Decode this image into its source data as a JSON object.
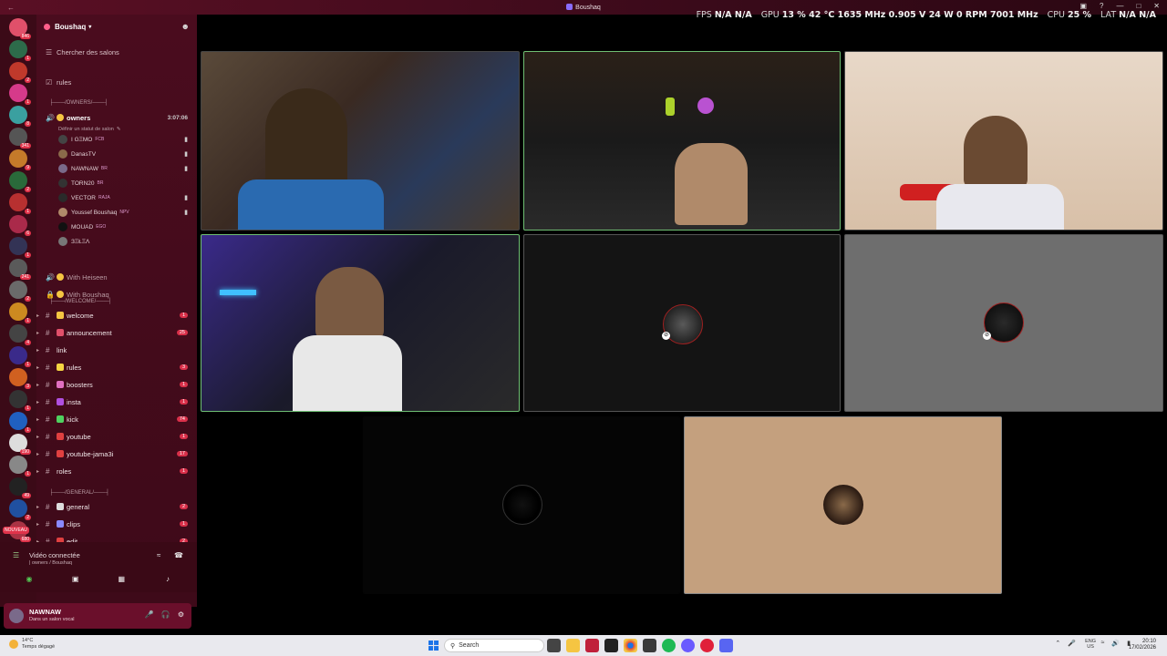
{
  "window": {
    "title": "Boushaq"
  },
  "overlay": {
    "fps_label": "FPS",
    "fps_a": "N/A",
    "fps_b": "N/A",
    "gpu_label": "GPU",
    "gpu_load": "13 %",
    "gpu_temp": "42 °C",
    "gpu_clock": "1635 MHz",
    "gpu_volt": "0.905 V",
    "gpu_power": "24 W",
    "gpu_fan": "0 RPM",
    "gpu_mem": "7001 MHz",
    "cpu_label": "CPU",
    "cpu_load": "25 %",
    "lat_label": "LAT",
    "lat_a": "N/A",
    "lat_b": "N/A"
  },
  "guilds": {
    "icons": [
      {
        "name": "discord-home",
        "color": "#e0506a",
        "badge": "846"
      },
      {
        "name": "guild-1",
        "color": "#2d6b4a",
        "badge": "1"
      },
      {
        "name": "guild-2",
        "color": "#c0392b",
        "badge": "2"
      },
      {
        "name": "guild-p",
        "color": "#d63a8a",
        "badge": "1"
      },
      {
        "name": "guild-4",
        "color": "#3aa0a0",
        "badge": "8"
      },
      {
        "name": "guild-5",
        "color": "#555",
        "badge": "341"
      },
      {
        "name": "guild-6",
        "color": "#c57a2a",
        "badge": "9"
      },
      {
        "name": "guild-7",
        "color": "#2a6a3a",
        "badge": "2"
      },
      {
        "name": "guild-8",
        "color": "#b83030",
        "badge": "1"
      },
      {
        "name": "guild-9",
        "color": "#aa2a4a",
        "badge": "6"
      },
      {
        "name": "guild-10",
        "color": "#335",
        "badge": "1"
      },
      {
        "name": "guild-11",
        "color": "#5a5a5a",
        "badge": "241"
      },
      {
        "name": "guild-12",
        "color": "#6a6a6a",
        "badge": "2"
      },
      {
        "name": "guild-13",
        "color": "#cc8a20",
        "badge": "1"
      },
      {
        "name": "guild-14",
        "color": "#444",
        "badge": "4"
      },
      {
        "name": "guild-15",
        "color": "#3a2a8a",
        "badge": "1"
      },
      {
        "name": "guild-16",
        "color": "#d06020",
        "badge": "3"
      },
      {
        "name": "guild-17",
        "color": "#333",
        "badge": "1"
      },
      {
        "name": "guild-18",
        "color": "#2060c0",
        "badge": "1"
      },
      {
        "name": "guild-19",
        "color": "#ddd",
        "badge": "190"
      },
      {
        "name": "guild-20",
        "color": "#888",
        "badge": "1"
      },
      {
        "name": "guild-21",
        "color": "#222",
        "badge": "49"
      },
      {
        "name": "guild-22",
        "color": "#2050a0",
        "badge": "2"
      },
      {
        "name": "guild-23",
        "color": "#aa3344",
        "badge": "680"
      }
    ],
    "nouveau": "NOUVEAU"
  },
  "sidebar": {
    "server_name": "Boushaq",
    "browse": "Chercher des salons",
    "rules_top": "rules",
    "cat_owners": "├───/OWNERS/───┤",
    "owners_channel": "owners",
    "owners_time": "3:07:06",
    "owners_status": "Définir un statut de salon",
    "members": [
      {
        "name": "I GΞMO",
        "tag": "FCB",
        "color": "#444",
        "cam": true
      },
      {
        "name": "DanasTV",
        "tag": "",
        "color": "#8a6a4a",
        "cam": true
      },
      {
        "name": "NAWNAW",
        "tag": "BR",
        "color": "#7a6a8a",
        "cam": true
      },
      {
        "name": "TORN20",
        "tag": "BR",
        "color": "#333",
        "cam": false
      },
      {
        "name": "VECTOR",
        "tag": "RAJA",
        "color": "#2a2a2a",
        "cam": true
      },
      {
        "name": "Youssef Boushaq",
        "tag": "NPV",
        "color": "#b08a6a",
        "cam": true
      },
      {
        "name": "MOUAD",
        "tag": "EGO",
        "color": "#111",
        "cam": false
      },
      {
        "name": "ЗΞŁΞΛ",
        "tag": "",
        "color": "#777",
        "cam": false
      }
    ],
    "voice2": "With Heiseen",
    "voice3": "With Boushaq",
    "cat_welcome": "├───/WELCOME/───┤",
    "channels": [
      {
        "label": "welcome",
        "count": "1",
        "emoji": "#f5c542"
      },
      {
        "label": "announcement",
        "count": "25",
        "emoji": "#e0506a"
      },
      {
        "label": "link",
        "count": "",
        "emoji": ""
      },
      {
        "label": "rules",
        "count": "3",
        "emoji": "#f5d442"
      },
      {
        "label": "boosters",
        "count": "1",
        "emoji": "#e070c0"
      },
      {
        "label": "insta",
        "count": "1",
        "emoji": "#b050e0"
      },
      {
        "label": "kick",
        "count": "74",
        "emoji": "#50d060"
      },
      {
        "label": "youtube",
        "count": "1",
        "emoji": "#e04040"
      },
      {
        "label": "youtube-jama3i",
        "count": "17",
        "emoji": "#e04040"
      },
      {
        "label": "roles",
        "count": "1",
        "emoji": ""
      }
    ],
    "cat_general": "├───/GENERAL/───┤",
    "general_channels": [
      {
        "label": "general",
        "count": "2",
        "emoji": "#ddd"
      },
      {
        "label": "clips",
        "count": "1",
        "emoji": "#8a8aff"
      },
      {
        "label": "edit",
        "count": "2",
        "emoji": "#e04040"
      }
    ],
    "voice_connected": "Vidéo connectée",
    "voice_location": "| owners / Boushaq",
    "user_name": "NAWNAW",
    "user_status": "Dans un salon vocal"
  },
  "taskbar": {
    "temp": "14°C",
    "weather": "Temps dégagé",
    "search": "Search",
    "lang_1": "ENG",
    "lang_2": "US",
    "time": "20:10",
    "date": "17/02/2026"
  },
  "colors": {
    "speaking": "#6fbf73",
    "accent": "#e0334a"
  }
}
